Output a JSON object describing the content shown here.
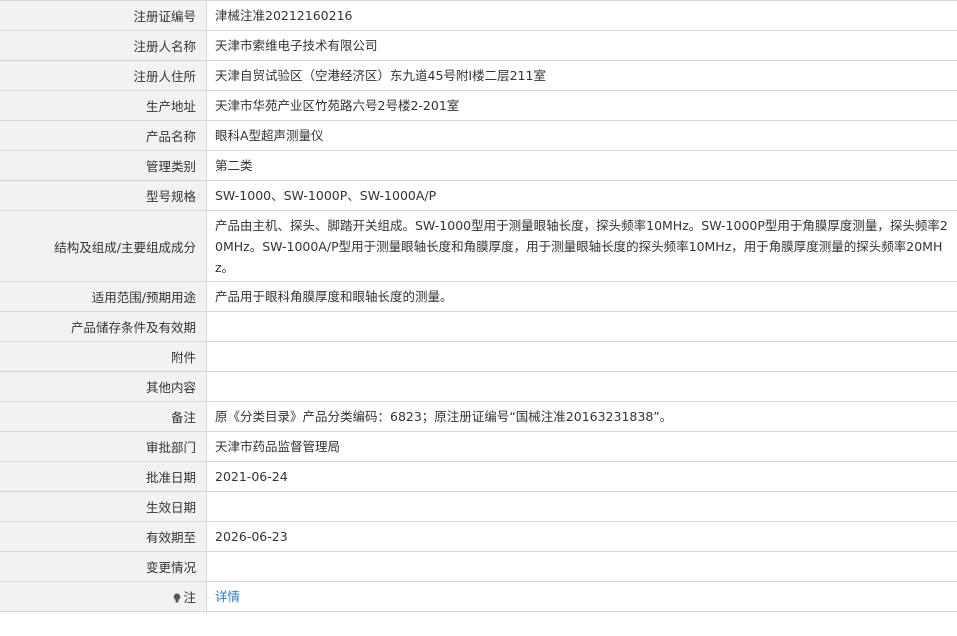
{
  "rows": [
    {
      "label": "注册证编号",
      "value": "津械注准20212160216"
    },
    {
      "label": "注册人名称",
      "value": "天津市索维电子技术有限公司"
    },
    {
      "label": "注册人住所",
      "value": "天津自贸试验区（空港经济区）东九道45号附Ⅰ楼二层211室"
    },
    {
      "label": "生产地址",
      "value": "天津市华苑产业区竹苑路六号2号楼2-201室"
    },
    {
      "label": "产品名称",
      "value": "眼科A型超声测量仪"
    },
    {
      "label": "管理类别",
      "value": "第二类"
    },
    {
      "label": "型号规格",
      "value": "SW-1000、SW-1000P、SW-1000A/P"
    },
    {
      "label": "结构及组成/主要组成成分",
      "value": "产品由主机、探头、脚踏开关组成。SW-1000型用于测量眼轴长度，探头频率10MHz。SW-1000P型用于角膜厚度测量，探头频率20MHz。SW-1000A/P型用于测量眼轴长度和角膜厚度，用于测量眼轴长度的探头频率10MHz，用于角膜厚度测量的探头频率20MHz。"
    },
    {
      "label": "适用范围/预期用途",
      "value": "产品用于眼科角膜厚度和眼轴长度的测量。"
    },
    {
      "label": "产品储存条件及有效期",
      "value": ""
    },
    {
      "label": "附件",
      "value": ""
    },
    {
      "label": "其他内容",
      "value": ""
    },
    {
      "label": "备注",
      "value": "原《分类目录》产品分类编码：6823；原注册证编号“国械注准20163231838”。"
    },
    {
      "label": "审批部门",
      "value": "天津市药品监督管理局"
    },
    {
      "label": "批准日期",
      "value": "2021-06-24"
    },
    {
      "label": "生效日期",
      "value": ""
    },
    {
      "label": "有效期至",
      "value": "2026-06-23"
    },
    {
      "label": "变更情况",
      "value": ""
    }
  ],
  "note": {
    "label": "注",
    "link_text": "详情",
    "icon": "lightbulb-icon"
  }
}
